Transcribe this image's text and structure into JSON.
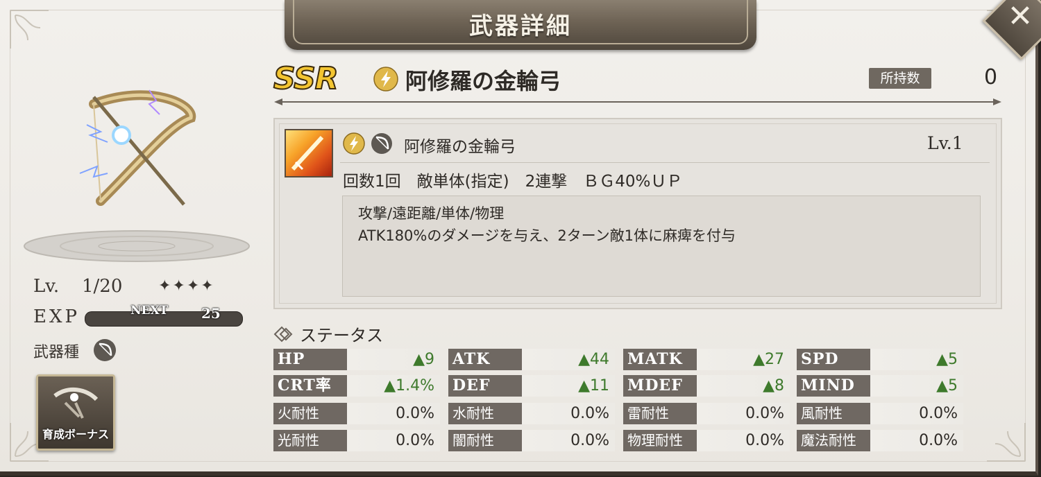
{
  "header": {
    "title": "武器詳細"
  },
  "weapon": {
    "rarity": "SSR",
    "name": "阿修羅の金輪弓",
    "owned_label": "所持数",
    "owned_count": "0",
    "level_label": "Lv.",
    "level": "1/20",
    "stars": "✦✦✦✦",
    "exp_label": "EXP",
    "next_label": "NEXT",
    "next_value": "25",
    "type_label": "武器種",
    "bonus_button": "育成ボーナス"
  },
  "skill": {
    "name": "阿修羅の金輪弓",
    "level": "Lv.1",
    "summary": "回数1回　敵単体(指定)　2連撃　ＢＧ40%ＵＰ",
    "desc_line1": "攻撃/遠距離/単体/物理",
    "desc_line2": "ATK180%のダメージを与え、2ターン敵1体に麻痺を付与"
  },
  "status": {
    "title": "ステータス",
    "rows": [
      [
        {
          "label": "HP",
          "value": "▲9"
        },
        {
          "label": "ATK",
          "value": "▲44"
        },
        {
          "label": "MATK",
          "value": "▲27"
        },
        {
          "label": "SPD",
          "value": "▲5"
        }
      ],
      [
        {
          "label": "CRT率",
          "value": "▲1.4%"
        },
        {
          "label": "DEF",
          "value": "▲11"
        },
        {
          "label": "MDEF",
          "value": "▲8"
        },
        {
          "label": "MIND",
          "value": "▲5"
        }
      ],
      [
        {
          "label": "火耐性",
          "value": "0.0%"
        },
        {
          "label": "水耐性",
          "value": "0.0%"
        },
        {
          "label": "雷耐性",
          "value": "0.0%"
        },
        {
          "label": "風耐性",
          "value": "0.0%"
        }
      ],
      [
        {
          "label": "光耐性",
          "value": "0.0%"
        },
        {
          "label": "闇耐性",
          "value": "0.0%"
        },
        {
          "label": "物理耐性",
          "value": "0.0%"
        },
        {
          "label": "魔法耐性",
          "value": "0.0%"
        }
      ]
    ]
  },
  "icons": {
    "element": "lightning-icon",
    "weapon_type": "bow-icon",
    "close": "close-icon",
    "status": "status-emblem-icon"
  },
  "colors": {
    "stat_up": "#3e7a2c",
    "label_bg": "#6f6862",
    "ssr_gold": "#f3c531"
  }
}
